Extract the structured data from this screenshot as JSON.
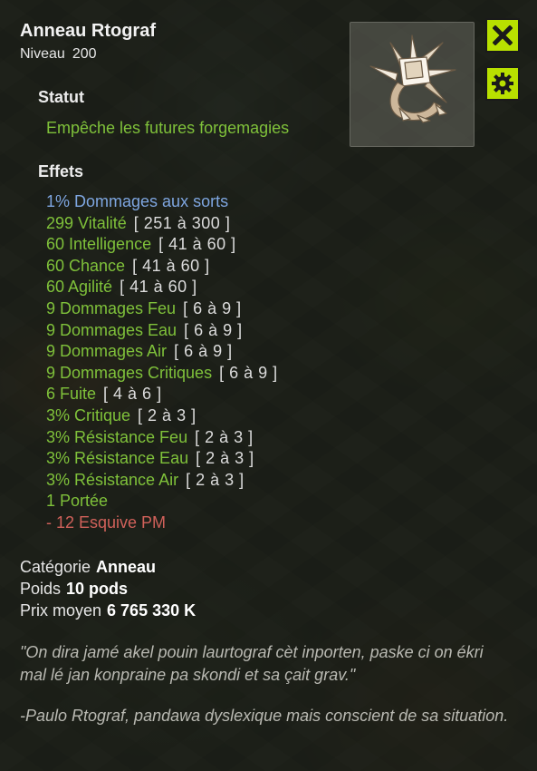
{
  "item": {
    "name": "Anneau Rtograf",
    "level_label": "Niveau",
    "level_value": "200"
  },
  "buttons": {
    "close_icon": "close-icon",
    "settings_icon": "gear-icon"
  },
  "status": {
    "title": "Statut",
    "text": "Empêche les futures forgemagies"
  },
  "effects": {
    "title": "Effets",
    "items": [
      {
        "text": "1% Dommages aux sorts",
        "range": "",
        "color": "#7ea6e0"
      },
      {
        "text": "299 Vitalité",
        "range": "[ 251 à 300 ]",
        "color": "#7fc13a"
      },
      {
        "text": "60 Intelligence",
        "range": "[ 41 à 60 ]",
        "color": "#7fc13a"
      },
      {
        "text": "60 Chance",
        "range": "[ 41 à 60 ]",
        "color": "#7fc13a"
      },
      {
        "text": "60 Agilité",
        "range": "[ 41 à 60 ]",
        "color": "#7fc13a"
      },
      {
        "text": "9 Dommages Feu",
        "range": "[ 6 à 9 ]",
        "color": "#7fc13a"
      },
      {
        "text": "9 Dommages Eau",
        "range": "[ 6 à 9 ]",
        "color": "#7fc13a"
      },
      {
        "text": "9 Dommages Air",
        "range": "[ 6 à 9 ]",
        "color": "#7fc13a"
      },
      {
        "text": "9 Dommages Critiques",
        "range": "[ 6 à 9 ]",
        "color": "#7fc13a"
      },
      {
        "text": "6 Fuite",
        "range": "[ 4 à 6 ]",
        "color": "#7fc13a"
      },
      {
        "text": "3% Critique",
        "range": "[ 2 à 3 ]",
        "color": "#7fc13a"
      },
      {
        "text": "3% Résistance Feu",
        "range": "[ 2 à 3 ]",
        "color": "#7fc13a"
      },
      {
        "text": "3% Résistance Eau",
        "range": "[ 2 à 3 ]",
        "color": "#7fc13a"
      },
      {
        "text": "3% Résistance Air",
        "range": "[ 2 à 3 ]",
        "color": "#7fc13a"
      },
      {
        "text": "1 Portée",
        "range": "",
        "color": "#7fc13a"
      },
      {
        "text": "- 12 Esquive PM",
        "range": "",
        "color": "#d0615a"
      }
    ]
  },
  "properties": {
    "category_label": "Catégorie",
    "category_value": "Anneau",
    "weight_label": "Poids",
    "weight_value": "10 pods",
    "price_label": "Prix moyen",
    "price_value": "6 765 330 K"
  },
  "description": {
    "quote": "\"On dira jamé akel pouin laurtograf cèt inporten, paske ci on ékri mal lé jan konpraine pa skondi et sa çait grav.\"",
    "signature": "-Paulo Rtograf, pandawa dyslexique mais conscient de sa situation."
  }
}
